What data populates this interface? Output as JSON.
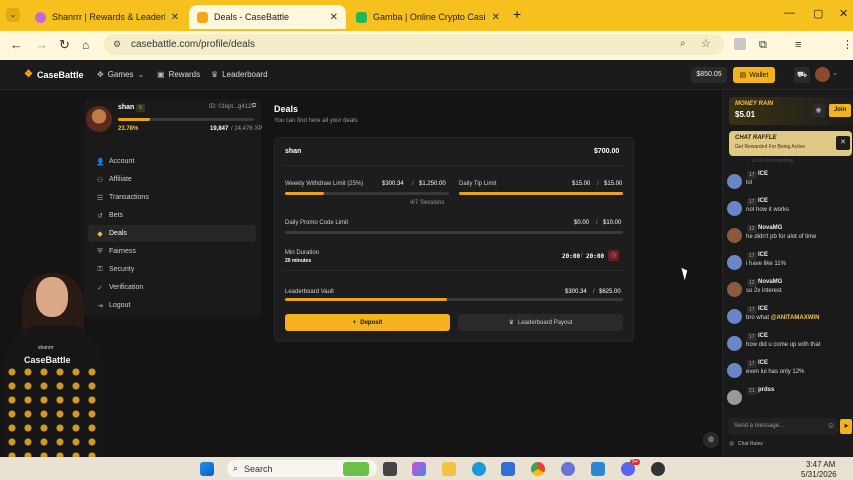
{
  "browser": {
    "tabs": [
      {
        "title": "Shanrrr | Rewards & Leaderboard",
        "active": false
      },
      {
        "title": "Deals - CaseBattle",
        "active": true
      },
      {
        "title": "Gamba | Online Crypto Casino",
        "active": false
      }
    ],
    "new_tab": "+",
    "url": "casebattle.com/profile/deals",
    "controls": {
      "minimize": "—",
      "maximize": "▢",
      "close": "✕"
    }
  },
  "site": {
    "logo": "CaseBattle",
    "nav": [
      {
        "label": "Games",
        "icon": "gamepad-icon",
        "dropdown": true
      },
      {
        "label": "Rewards",
        "icon": "gift-icon"
      },
      {
        "label": "Leaderboard",
        "icon": "trophy-icon"
      }
    ],
    "balance": "$850.05",
    "wallet_label": "Wallet"
  },
  "profile": {
    "username": "shan",
    "level": "9",
    "id_text": "ID: 01kpt...g412f",
    "progress_pct_label": "23.78%",
    "progress": 0.2378,
    "xp_current": "19,847",
    "xp_total": "/ 24,476 XP",
    "menu": [
      {
        "label": "Account",
        "icon": "user-icon",
        "active": false
      },
      {
        "label": "Affiliate",
        "icon": "users-icon",
        "active": false
      },
      {
        "label": "Transactions",
        "icon": "list-icon",
        "active": false
      },
      {
        "label": "Bets",
        "icon": "history-icon",
        "active": false
      },
      {
        "label": "Deals",
        "icon": "diamond-icon",
        "active": true
      },
      {
        "label": "Fairness",
        "icon": "shield-icon",
        "active": false
      },
      {
        "label": "Security",
        "icon": "lock-icon",
        "active": false
      },
      {
        "label": "Verification",
        "icon": "check-shield-icon",
        "active": false
      },
      {
        "label": "Logout",
        "icon": "logout-icon",
        "active": false
      }
    ]
  },
  "deals": {
    "title": "Deals",
    "subtitle": "You can find here all your deals",
    "card": {
      "name": "shan",
      "amount": "$700.00",
      "weekly_withdraw": {
        "label": "Weekly Withdraw Limit (25%)",
        "current": "$300.34",
        "sep": "/",
        "max": "$1,250.00",
        "progress": 0.24
      },
      "daily_tip": {
        "label": "Daily Tip Limit",
        "current": "$15.00",
        "sep": "/",
        "max": "$15.00",
        "progress": 1.0
      },
      "sessions": "4/7 Sessions",
      "daily_promo": {
        "label": "Daily Promo Code Limit",
        "current": "$0.00",
        "sep": "/",
        "max": "$10.00",
        "progress": 0.0
      },
      "min_duration": {
        "label": "Min Duration",
        "value": "20 minutes",
        "timer_current": "20:00",
        "timer_sep": "/",
        "timer_max": "20:00"
      },
      "leaderboard_vault": {
        "label": "Leaderboard Vault",
        "current": "$300.34",
        "sep": "/",
        "max": "$625.00",
        "progress": 0.48
      },
      "deposit_label": "Deposit",
      "payout_label": "Leaderboard Payout"
    }
  },
  "chat": {
    "money_rain": {
      "title": "MONEY RAIN",
      "amount": "$5.01",
      "join": "Join"
    },
    "raffle": {
      "title": "CHAT RAFFLE",
      "subtitle": "Get Rewarded For Being Active"
    },
    "faded_text": "… is 13 won morning",
    "messages": [
      {
        "level": "17",
        "name": "ICE",
        "text": "lol",
        "avatar": "#6a85c8"
      },
      {
        "level": "17",
        "name": "ICE",
        "text": "not how it works",
        "avatar": "#6a85c8"
      },
      {
        "level": "12",
        "name": "NovaMG",
        "text": "he didn't pb for alot of time",
        "avatar": "#8a5a3a"
      },
      {
        "level": "17",
        "name": "ICE",
        "text": "i have like 11%",
        "avatar": "#6a85c8"
      },
      {
        "level": "12",
        "name": "NovaMG",
        "text": "so 2x interest",
        "avatar": "#8a5a3a"
      },
      {
        "level": "17",
        "name": "ICE",
        "text": "bro what @ANITAMAXWIN",
        "avatar": "#6a85c8"
      },
      {
        "level": "17",
        "name": "ICE",
        "text": "how did u come up with that",
        "avatar": "#6a85c8"
      },
      {
        "level": "17",
        "name": "ICE",
        "text": "even lui has only 12%",
        "avatar": "#6a85c8"
      },
      {
        "level": "21",
        "name": "prdss",
        "text": "",
        "avatar": "#9a9a9a"
      }
    ],
    "input_placeholder": "Send a message...",
    "rules_label": "Chat Rules"
  },
  "streamer": {
    "shirt_text": "CaseBattle",
    "chain_text": "shanrrr"
  },
  "taskbar": {
    "search_label": "Search",
    "time": "3:47 AM",
    "date": "5/31/2026",
    "badge_count": "9+"
  }
}
